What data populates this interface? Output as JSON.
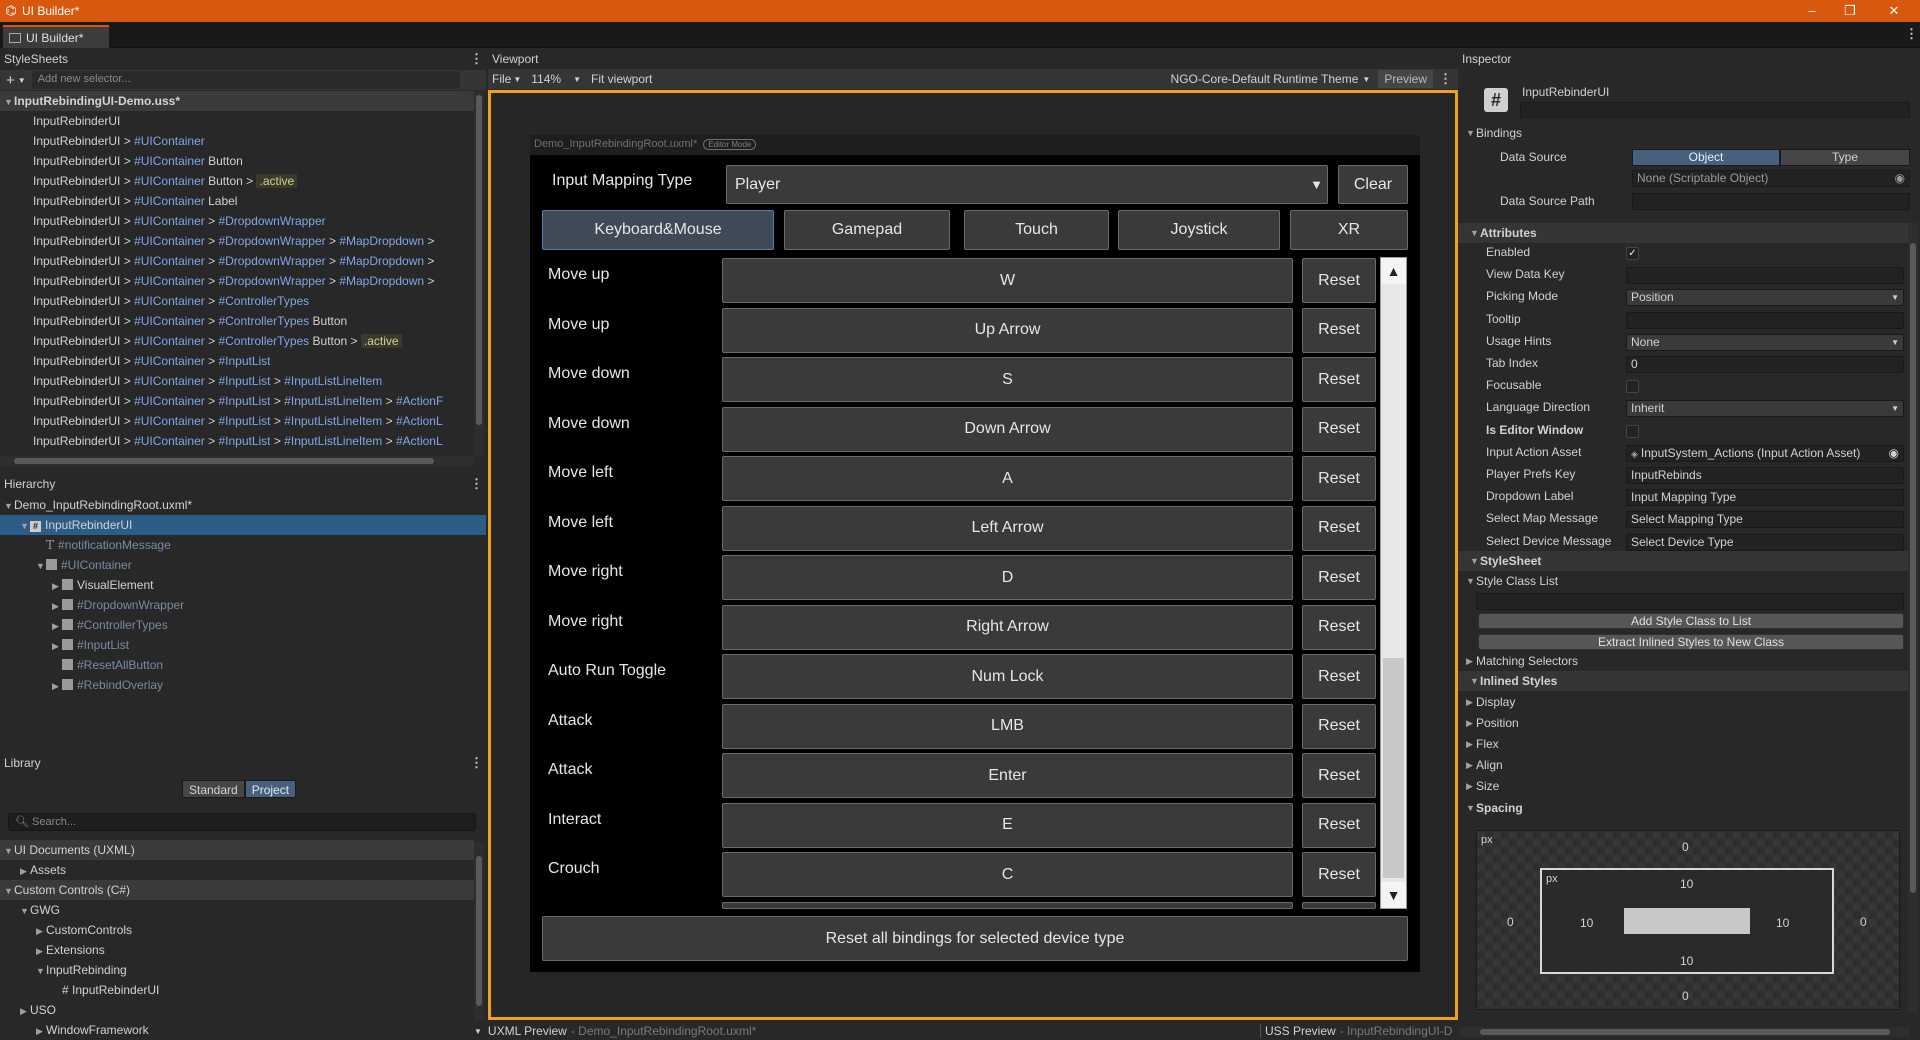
{
  "window": {
    "title": "UI Builder*",
    "tab": "UI Builder*",
    "minimize": "–",
    "restore": "❐",
    "close": "✕"
  },
  "stylesheets": {
    "title": "StyleSheets",
    "add_placeholder": "Add new selector...",
    "file": "InputRebindingUI-Demo.uss*",
    "rows": [
      [
        [
          "InputRebinderUI",
          ""
        ]
      ],
      [
        [
          "InputRebinderUI > ",
          ""
        ],
        [
          "#UIContainer",
          "blue"
        ]
      ],
      [
        [
          "InputRebinderUI > ",
          ""
        ],
        [
          "#UIContainer",
          "blue"
        ],
        [
          "  Button",
          ""
        ]
      ],
      [
        [
          "InputRebinderUI > ",
          ""
        ],
        [
          "#UIContainer",
          "blue"
        ],
        [
          "  Button > ",
          ""
        ],
        [
          ".active",
          "yel"
        ]
      ],
      [
        [
          "InputRebinderUI > ",
          ""
        ],
        [
          "#UIContainer",
          "blue"
        ],
        [
          "  Label",
          ""
        ]
      ],
      [
        [
          "InputRebinderUI > ",
          ""
        ],
        [
          "#UIContainer",
          "blue"
        ],
        [
          " > ",
          ""
        ],
        [
          "#DropdownWrapper",
          "blue"
        ]
      ],
      [
        [
          "InputRebinderUI > ",
          ""
        ],
        [
          "#UIContainer",
          "blue"
        ],
        [
          " > ",
          ""
        ],
        [
          "#DropdownWrapper",
          "blue"
        ],
        [
          " > ",
          ""
        ],
        [
          "#MapDropdown",
          "blue"
        ],
        [
          " >",
          ""
        ]
      ],
      [
        [
          "InputRebinderUI > ",
          ""
        ],
        [
          "#UIContainer",
          "blue"
        ],
        [
          " > ",
          ""
        ],
        [
          "#DropdownWrapper",
          "blue"
        ],
        [
          " > ",
          ""
        ],
        [
          "#MapDropdown",
          "blue"
        ],
        [
          " >",
          ""
        ]
      ],
      [
        [
          "InputRebinderUI > ",
          ""
        ],
        [
          "#UIContainer",
          "blue"
        ],
        [
          " > ",
          ""
        ],
        [
          "#DropdownWrapper",
          "blue"
        ],
        [
          " > ",
          ""
        ],
        [
          "#MapDropdown",
          "blue"
        ],
        [
          " >",
          ""
        ]
      ],
      [
        [
          "InputRebinderUI > ",
          ""
        ],
        [
          "#UIContainer",
          "blue"
        ],
        [
          " > ",
          ""
        ],
        [
          "#ControllerTypes",
          "blue"
        ]
      ],
      [
        [
          "InputRebinderUI > ",
          ""
        ],
        [
          "#UIContainer",
          "blue"
        ],
        [
          " > ",
          ""
        ],
        [
          "#ControllerTypes",
          "blue"
        ],
        [
          "  Button",
          ""
        ]
      ],
      [
        [
          "InputRebinderUI > ",
          ""
        ],
        [
          "#UIContainer",
          "blue"
        ],
        [
          " > ",
          ""
        ],
        [
          "#ControllerTypes",
          "blue"
        ],
        [
          "  Button > ",
          ""
        ],
        [
          ".active",
          "yel"
        ]
      ],
      [
        [
          "InputRebinderUI > ",
          ""
        ],
        [
          "#UIContainer",
          "blue"
        ],
        [
          " > ",
          ""
        ],
        [
          "#InputList",
          "blue"
        ]
      ],
      [
        [
          "InputRebinderUI > ",
          ""
        ],
        [
          "#UIContainer",
          "blue"
        ],
        [
          " > ",
          ""
        ],
        [
          "#InputList",
          "blue"
        ],
        [
          " > ",
          ""
        ],
        [
          "#InputListLineItem",
          "blue"
        ]
      ],
      [
        [
          "InputRebinderUI > ",
          ""
        ],
        [
          "#UIContainer",
          "blue"
        ],
        [
          " > ",
          ""
        ],
        [
          "#InputList",
          "blue"
        ],
        [
          " > ",
          ""
        ],
        [
          "#InputListLineItem",
          "blue"
        ],
        [
          " > ",
          ""
        ],
        [
          "#ActionF",
          "blue"
        ]
      ],
      [
        [
          "InputRebinderUI > ",
          ""
        ],
        [
          "#UIContainer",
          "blue"
        ],
        [
          " > ",
          ""
        ],
        [
          "#InputList",
          "blue"
        ],
        [
          " > ",
          ""
        ],
        [
          "#InputListLineItem",
          "blue"
        ],
        [
          " > ",
          ""
        ],
        [
          "#ActionL",
          "blue"
        ]
      ],
      [
        [
          "InputRebinderUI > ",
          ""
        ],
        [
          "#UIContainer",
          "blue"
        ],
        [
          " > ",
          ""
        ],
        [
          "#InputList",
          "blue"
        ],
        [
          " > ",
          ""
        ],
        [
          "#InputListLineItem",
          "blue"
        ],
        [
          " > ",
          ""
        ],
        [
          "#ActionL",
          "blue"
        ]
      ]
    ]
  },
  "hierarchy": {
    "title": "Hierarchy",
    "root": "Demo_InputRebindingRoot.uxml*",
    "items": [
      {
        "label": "InputRebinderUI",
        "indent": 1,
        "arrow": "▼",
        "icon": "hash",
        "cls": ""
      },
      {
        "label": "#notificationMessage",
        "indent": 2,
        "arrow": "",
        "icon": "T",
        "cls": "faded"
      },
      {
        "label": "#UIContainer",
        "indent": 2,
        "arrow": "▼",
        "icon": "sq",
        "cls": "faded"
      },
      {
        "label": "VisualElement",
        "indent": 3,
        "arrow": "▶",
        "icon": "sq",
        "cls": ""
      },
      {
        "label": "#DropdownWrapper",
        "indent": 3,
        "arrow": "▶",
        "icon": "sq",
        "cls": "faded"
      },
      {
        "label": "#ControllerTypes",
        "indent": 3,
        "arrow": "▶",
        "icon": "sq",
        "cls": "faded"
      },
      {
        "label": "#InputList",
        "indent": 3,
        "arrow": "▶",
        "icon": "sq",
        "cls": "faded"
      },
      {
        "label": "#ResetAllButton",
        "indent": 3,
        "arrow": "",
        "icon": "btn",
        "cls": "faded"
      },
      {
        "label": "#RebindOverlay",
        "indent": 3,
        "arrow": "▶",
        "icon": "sq",
        "cls": "faded"
      }
    ]
  },
  "library": {
    "title": "Library",
    "tab_standard": "Standard",
    "tab_project": "Project",
    "search": "Search...",
    "items": [
      {
        "label": "UI Documents (UXML)",
        "indent": 0,
        "arrow": "▼",
        "section": true
      },
      {
        "label": "Assets",
        "indent": 1,
        "arrow": "▶",
        "section": false
      },
      {
        "label": "Custom Controls (C#)",
        "indent": 0,
        "arrow": "▼",
        "section": true
      },
      {
        "label": "GWG",
        "indent": 1,
        "arrow": "▼",
        "section": false
      },
      {
        "label": "CustomControls",
        "indent": 2,
        "arrow": "▶",
        "section": false
      },
      {
        "label": "Extensions",
        "indent": 2,
        "arrow": "▶",
        "section": false
      },
      {
        "label": "InputRebinding",
        "indent": 2,
        "arrow": "▼",
        "section": false
      },
      {
        "label": "# InputRebinderUI",
        "indent": 3,
        "arrow": "",
        "section": false
      },
      {
        "label": "USO",
        "indent": 1,
        "arrow": "▶",
        "section": false
      },
      {
        "label": "WindowFramework",
        "indent": 2,
        "arrow": "▶",
        "section": false
      }
    ]
  },
  "viewport": {
    "title": "Viewport",
    "file": "File",
    "zoom": "114%",
    "fit": "Fit viewport",
    "theme": "NGO-Core-Default Runtime Theme",
    "preview": "Preview",
    "doc_name": "Demo_InputRebindingRoot.uxml*",
    "mode_badge": "Editor Mode"
  },
  "rebinder": {
    "mapping_label": "Input Mapping Type",
    "mapping_value": "Player",
    "clear": "Clear",
    "devices": [
      "Keyboard&Mouse",
      "Gamepad",
      "Touch",
      "Joystick",
      "XR"
    ],
    "bindings": [
      {
        "action": "Move up",
        "key": "W"
      },
      {
        "action": "Move up",
        "key": "Up Arrow"
      },
      {
        "action": "Move down",
        "key": "S"
      },
      {
        "action": "Move down",
        "key": "Down Arrow"
      },
      {
        "action": "Move left",
        "key": "A"
      },
      {
        "action": "Move left",
        "key": "Left Arrow"
      },
      {
        "action": "Move right",
        "key": "D"
      },
      {
        "action": "Move right",
        "key": "Right Arrow"
      },
      {
        "action": "Auto Run Toggle",
        "key": "Num Lock"
      },
      {
        "action": "Attack",
        "key": "LMB"
      },
      {
        "action": "Attack",
        "key": "Enter"
      },
      {
        "action": "Interact",
        "key": "E"
      },
      {
        "action": "Crouch",
        "key": "C"
      }
    ],
    "reset": "Reset",
    "reset_all": "Reset all bindings for selected device type"
  },
  "inspector": {
    "title": "Inspector",
    "element": "InputRebinderUI",
    "bindings": "Bindings",
    "data_source": "Data Source",
    "object": "Object",
    "type": "Type",
    "none_value": "None (Scriptable Object)",
    "data_source_path": "Data Source Path",
    "attributes": "Attributes",
    "fields": [
      {
        "label": "Enabled",
        "value": "✓",
        "kind": "check"
      },
      {
        "label": "View Data Key",
        "value": "",
        "kind": "text"
      },
      {
        "label": "Picking Mode",
        "value": "Position",
        "kind": "drop"
      },
      {
        "label": "Tooltip",
        "value": "",
        "kind": "text"
      },
      {
        "label": "Usage Hints",
        "value": "None",
        "kind": "drop"
      },
      {
        "label": "Tab Index",
        "value": "0",
        "kind": "text"
      },
      {
        "label": "Focusable",
        "value": "",
        "kind": "check"
      },
      {
        "label": "Language Direction",
        "value": "Inherit",
        "kind": "drop"
      },
      {
        "label": "Is Editor Window",
        "value": "",
        "kind": "check",
        "bold": true
      },
      {
        "label": "Input Action Asset",
        "value": "InputSystem_Actions (Input Action Asset)",
        "kind": "obj"
      },
      {
        "label": "Player Prefs Key",
        "value": "InputRebinds",
        "kind": "text"
      },
      {
        "label": "Dropdown Label",
        "value": "Input Mapping Type",
        "kind": "text"
      },
      {
        "label": "Select Map Message",
        "value": "Select Mapping Type",
        "kind": "text"
      },
      {
        "label": "Select Device Message",
        "value": "Select Device Type",
        "kind": "text"
      }
    ],
    "stylesheet": "StyleSheet",
    "style_class_list": "Style Class List",
    "add_class": "Add Style Class to List",
    "extract": "Extract Inlined Styles to New Class",
    "matching": "Matching Selectors",
    "inlined": "Inlined Styles",
    "groups": [
      "Display",
      "Position",
      "Flex",
      "Align",
      "Size"
    ],
    "spacing": "Spacing",
    "spacing_box": {
      "unit": "px",
      "margin": {
        "top": "0",
        "left": "0",
        "right": "0",
        "bottom": "0"
      },
      "padding": {
        "top": "10",
        "left": "10",
        "right": "10",
        "bottom": "10"
      }
    }
  },
  "bottom": {
    "uxml_preview": "UXML Preview",
    "uxml_file": "- Demo_InputRebindingRoot.uxml*",
    "uss_preview": "USS Preview",
    "uss_file": "- InputRebindingUI-D"
  }
}
